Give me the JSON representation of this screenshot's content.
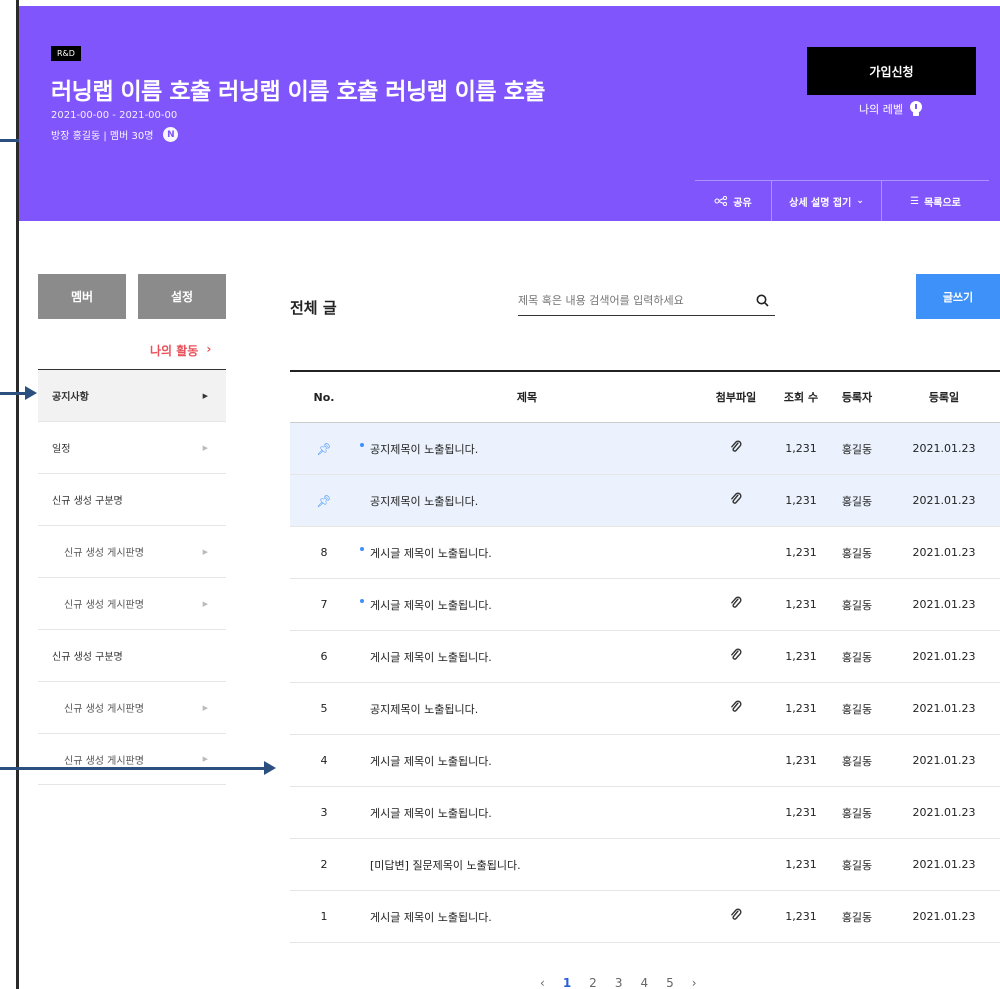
{
  "hero": {
    "badge": "R&D",
    "title": "러닝랩 이름 호출 러닝랩 이름 호출 러닝랩 이름 호출",
    "date": "2021-00-00 - 2021-00-00",
    "meta": "방장 홍길동  |  멤버 30명",
    "n_badge": "N",
    "join_label": "가입신청",
    "level_label": "나의 레벨",
    "actions": [
      {
        "label": "공유",
        "icon": "share-icon"
      },
      {
        "label": "상세 설명 접기",
        "icon": "chevron-down-icon"
      },
      {
        "label": "목록으로",
        "icon": "list-icon"
      }
    ],
    "colors": {
      "background": "#8055fb",
      "join_bg": "#000000"
    }
  },
  "sidebar": {
    "member_label": "멤버",
    "settings_label": "설정",
    "my_activity_label": "나의 활동",
    "items": [
      {
        "label": "공지사항",
        "active": true
      },
      {
        "label": "일정"
      },
      {
        "label": "신규 생성 구분명"
      },
      {
        "label": "신규 생성 게시판명",
        "sub": true
      },
      {
        "label": "신규 생성 게시판명",
        "sub": true
      },
      {
        "label": "신규 생성 구분명"
      },
      {
        "label": "신규 생성 게시판명",
        "sub": true
      },
      {
        "label": "신규 생성 게시판명",
        "sub": true
      }
    ]
  },
  "board": {
    "title": "전체 글",
    "search_placeholder": "제목 혹은 내용 검색어를 입력하세요",
    "write_label": "글쓰기",
    "accent": "#3f91fa",
    "columns": [
      "No.",
      "제목",
      "첨부파일",
      "조회 수",
      "등록자",
      "등록일"
    ],
    "rows": [
      {
        "no": "",
        "pinned": true,
        "new": true,
        "title": "공지제목이 노출됩니다.",
        "attach": true,
        "views": "1,231",
        "author": "홍길동",
        "date": "2021.01.23"
      },
      {
        "no": "",
        "pinned": true,
        "new": false,
        "title": "공지제목이 노출됩니다.",
        "attach": true,
        "views": "1,231",
        "author": "홍길동",
        "date": "2021.01.23"
      },
      {
        "no": "8",
        "new": true,
        "title": "게시글 제목이 노출됩니다.",
        "attach": false,
        "views": "1,231",
        "author": "홍길동",
        "date": "2021.01.23"
      },
      {
        "no": "7",
        "new": true,
        "title": "게시글 제목이 노출됩니다.",
        "attach": true,
        "views": "1,231",
        "author": "홍길동",
        "date": "2021.01.23"
      },
      {
        "no": "6",
        "title": "게시글 제목이 노출됩니다.",
        "attach": true,
        "views": "1,231",
        "author": "홍길동",
        "date": "2021.01.23"
      },
      {
        "no": "5",
        "title": "공지제목이 노출됩니다.",
        "attach": true,
        "views": "1,231",
        "author": "홍길동",
        "date": "2021.01.23"
      },
      {
        "no": "4",
        "title": "게시글 제목이 노출됩니다.",
        "attach": false,
        "views": "1,231",
        "author": "홍길동",
        "date": "2021.01.23"
      },
      {
        "no": "3",
        "title": "게시글 제목이 노출됩니다.",
        "attach": false,
        "views": "1,231",
        "author": "홍길동",
        "date": "2021.01.23"
      },
      {
        "no": "2",
        "title": "[미답변] 질문제목이 노출됩니다.",
        "attach": false,
        "views": "1,231",
        "author": "홍길동",
        "date": "2021.01.23"
      },
      {
        "no": "1",
        "title": "게시글 제목이 노출됩니다.",
        "attach": true,
        "views": "1,231",
        "author": "홍길동",
        "date": "2021.01.23"
      }
    ]
  },
  "pager": {
    "prev": "‹",
    "pages": [
      "1",
      "2",
      "3",
      "4",
      "5"
    ],
    "current": "1",
    "next": "›"
  }
}
